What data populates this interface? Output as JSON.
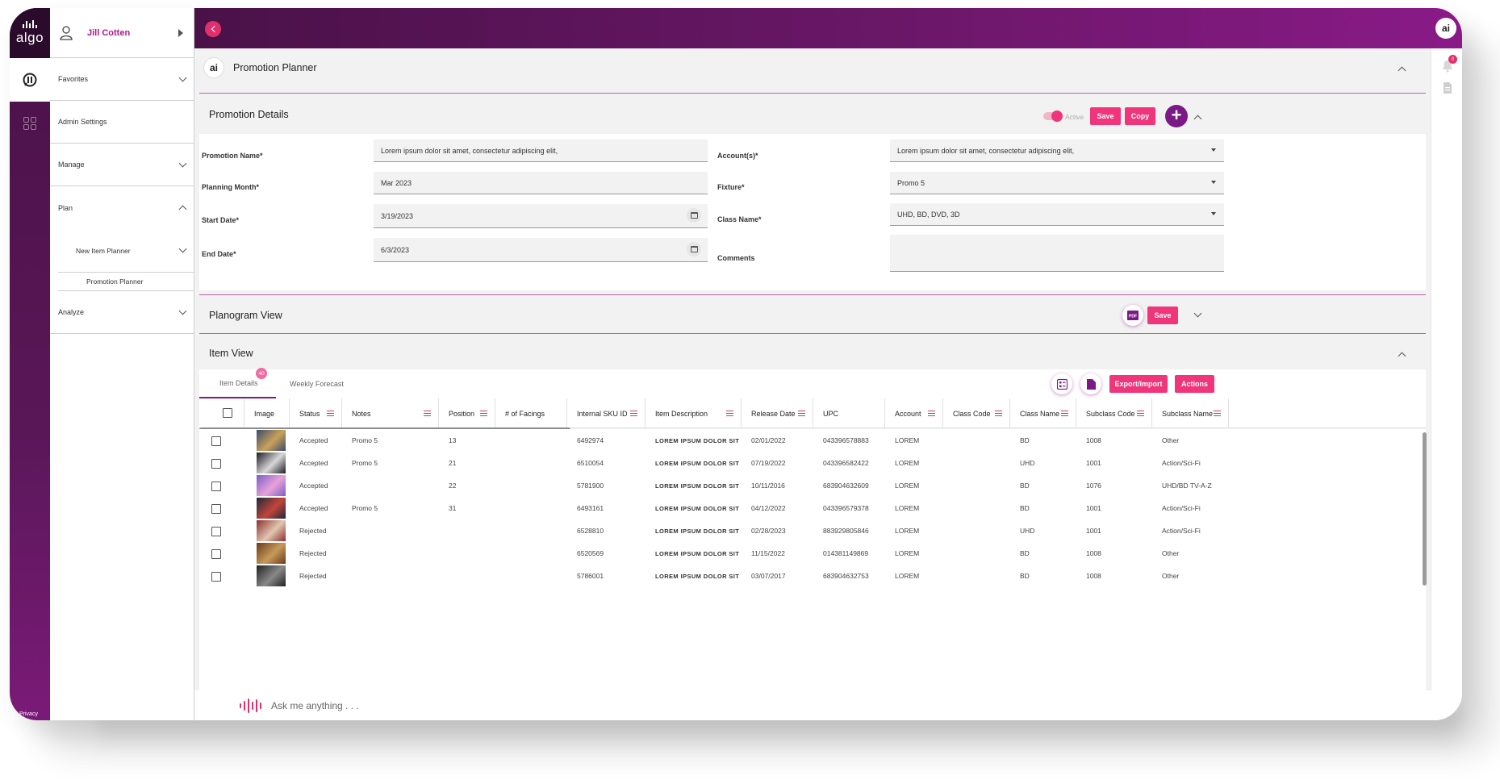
{
  "user": {
    "name": "Jill Cotten"
  },
  "rail": {
    "logo_text": "algo",
    "privacy": "Privacy"
  },
  "nav": {
    "items": [
      {
        "label": "Favorites",
        "expanded": false
      },
      {
        "label": "Admin Settings"
      },
      {
        "label": "Manage",
        "expanded": false
      },
      {
        "label": "Plan",
        "expanded": true
      }
    ],
    "plan_sub": {
      "label": "New Item Planner"
    },
    "plan_sub2": {
      "label": "Promotion Planner"
    },
    "analyze": {
      "label": "Analyze"
    }
  },
  "header": {
    "badge": "ai",
    "title": "Promotion Planner"
  },
  "notifications": {
    "count": "0"
  },
  "promotion_details": {
    "title": "Promotion Details",
    "toggle_label": "Active",
    "save_label": "Save",
    "copy_label": "Copy",
    "add_label": "+",
    "fields": {
      "promotion_name": {
        "label": "Promotion Name*",
        "value": "Lorem ipsum dolor sit amet, consectetur adipiscing elit,"
      },
      "planning_month": {
        "label": "Planning Month*",
        "value": "Mar 2023"
      },
      "start_date": {
        "label": "Start Date*",
        "value": "3/19/2023"
      },
      "end_date": {
        "label": "End Date*",
        "value": "6/3/2023"
      },
      "accounts": {
        "label": "Account(s)*",
        "value": "Lorem ipsum dolor sit amet, consectetur adipiscing elit,"
      },
      "fixture": {
        "label": "Fixture*",
        "value": "Promo 5"
      },
      "class_name": {
        "label": "Class Name*",
        "value": "UHD, BD, DVD, 3D"
      },
      "comments": {
        "label": "Comments",
        "value": ""
      }
    }
  },
  "planogram": {
    "title": "Planogram View",
    "save_label": "Save",
    "pdf_label": "PDF"
  },
  "item_view": {
    "title": "Item View",
    "tabs": [
      {
        "label": "Item Details",
        "badge": "40"
      },
      {
        "label": "Weekly Forecast"
      }
    ],
    "export_label": "Export/Import",
    "actions_label": "Actions",
    "columns": [
      "Image",
      "Status",
      "Notes",
      "Position",
      "# of Facings",
      "Internal SKU ID",
      "Item Description",
      "Release Date",
      "UPC",
      "Account",
      "Class Code",
      "Class Name",
      "Subclass Code",
      "Subclass Name"
    ],
    "rows": [
      {
        "status": "Accepted",
        "notes": "Promo 5",
        "position": "13",
        "facings": "",
        "sku": "6492974",
        "desc": "LOREM IPSUM DOLOR SIT",
        "release": "02/01/2022",
        "upc": "043396578883",
        "account": "LOREM",
        "class_code": "",
        "class_name": "BD",
        "subclass_code": "1008",
        "subclass_name": "Other",
        "thumb": [
          "#3b4a6b",
          "#c9a25a"
        ]
      },
      {
        "status": "Accepted",
        "notes": "Promo 5",
        "position": "21",
        "facings": "",
        "sku": "6510054",
        "desc": "LOREM IPSUM DOLOR SIT",
        "release": "07/19/2022",
        "upc": "043396582422",
        "account": "LOREM",
        "class_code": "",
        "class_name": "UHD",
        "subclass_code": "1001",
        "subclass_name": "Action/Sci-Fi",
        "thumb": [
          "#1c1c22",
          "#d8d8d8"
        ]
      },
      {
        "status": "Accepted",
        "notes": "",
        "position": "22",
        "facings": "",
        "sku": "5781900",
        "desc": "LOREM IPSUM DOLOR SIT",
        "release": "10/11/2016",
        "upc": "683904632609",
        "account": "LOREM",
        "class_code": "",
        "class_name": "BD",
        "subclass_code": "1076",
        "subclass_name": "UHD/BD TV-A-Z",
        "thumb": [
          "#7b5fc7",
          "#e7a2d9"
        ]
      },
      {
        "status": "Accepted",
        "notes": "Promo 5",
        "position": "31",
        "facings": "",
        "sku": "6493161",
        "desc": "LOREM IPSUM DOLOR SIT",
        "release": "04/12/2022",
        "upc": "043396579378",
        "account": "LOREM",
        "class_code": "",
        "class_name": "BD",
        "subclass_code": "1001",
        "subclass_name": "Action/Sci-Fi",
        "thumb": [
          "#1d2a3a",
          "#c4443a"
        ]
      },
      {
        "status": "Rejected",
        "notes": "",
        "position": "",
        "facings": "",
        "sku": "6528810",
        "desc": "LOREM IPSUM DOLOR SIT",
        "release": "02/28/2023",
        "upc": "883929805846",
        "account": "LOREM",
        "class_code": "",
        "class_name": "UHD",
        "subclass_code": "1001",
        "subclass_name": "Action/Sci-Fi",
        "thumb": [
          "#8a2f2f",
          "#e0c7b0"
        ]
      },
      {
        "status": "Rejected",
        "notes": "",
        "position": "",
        "facings": "",
        "sku": "6520569",
        "desc": "LOREM IPSUM DOLOR SIT",
        "release": "11/15/2022",
        "upc": "014381149869",
        "account": "LOREM",
        "class_code": "",
        "class_name": "BD",
        "subclass_code": "1008",
        "subclass_name": "Other",
        "thumb": [
          "#6a3a1a",
          "#c79a5a"
        ]
      },
      {
        "status": "Rejected",
        "notes": "",
        "position": "",
        "facings": "",
        "sku": "5786001",
        "desc": "LOREM IPSUM DOLOR SIT",
        "release": "03/07/2017",
        "upc": "683904632753",
        "account": "LOREM",
        "class_code": "",
        "class_name": "BD",
        "subclass_code": "1008",
        "subclass_name": "Other",
        "thumb": [
          "#222222",
          "#888888"
        ]
      }
    ]
  },
  "ask": {
    "placeholder": "Ask me anything . . ."
  },
  "colors": {
    "accent": "#f0357a",
    "brand": "#7b1a86",
    "header_start": "#4a1148",
    "header_end": "#8a1a88"
  },
  "icons": {
    "user": "user-icon",
    "pdf": "pdf-icon",
    "calendar": "calendar-icon",
    "bell": "bell-icon"
  }
}
